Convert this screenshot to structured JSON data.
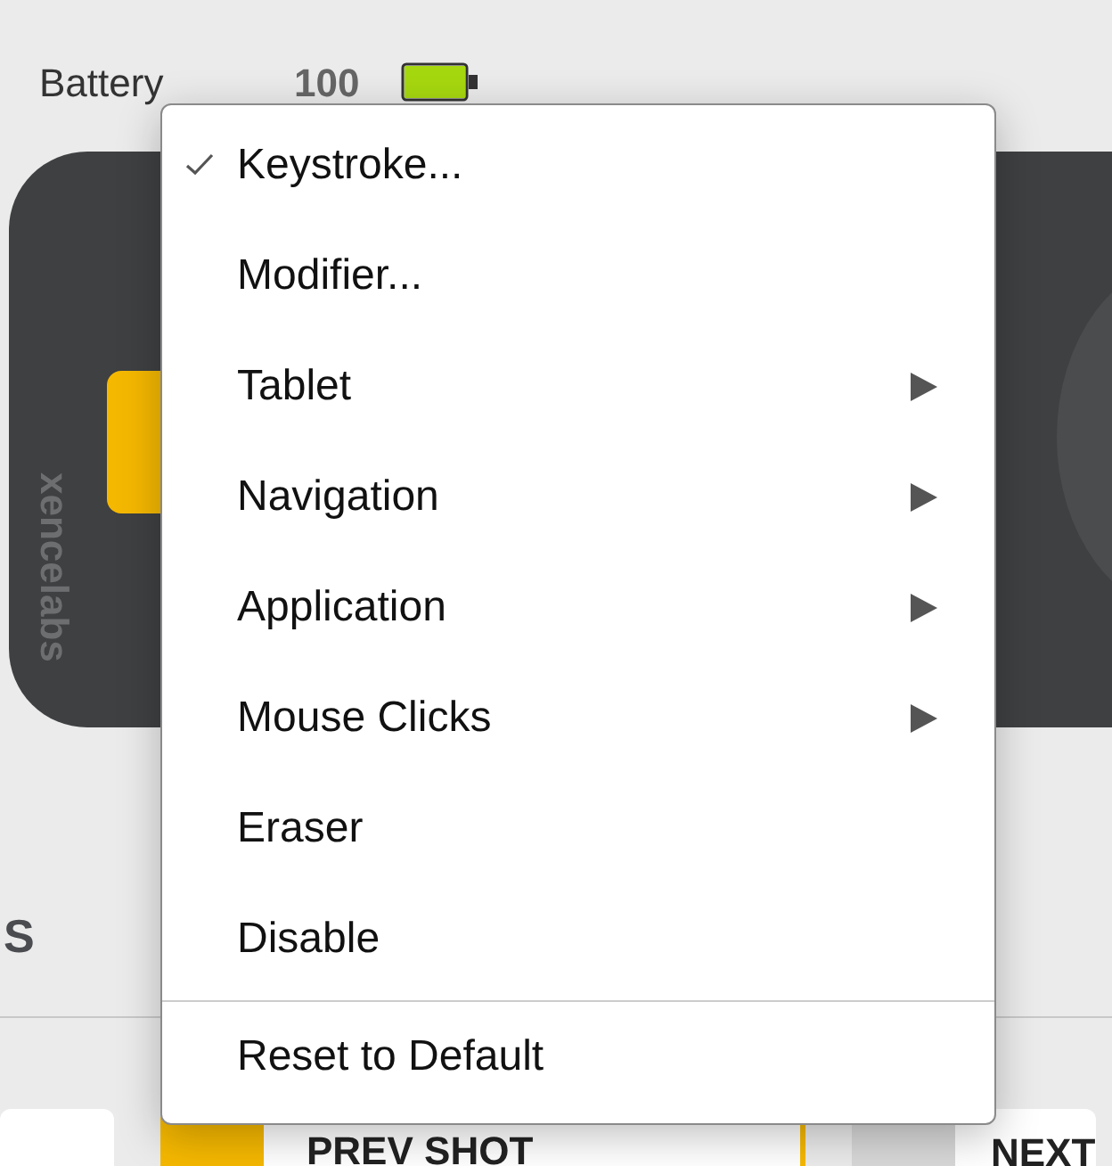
{
  "status": {
    "label": "Battery",
    "value": "100"
  },
  "device": {
    "logo": "xencelabs"
  },
  "section_label": "S",
  "buttons": [
    {
      "label": "PREV SHOT",
      "selected": true
    },
    {
      "label": "NEXT",
      "selected": false
    }
  ],
  "context_menu": {
    "groups": [
      {
        "items": [
          {
            "label": "Keystroke...",
            "checked": true,
            "has_submenu": false
          },
          {
            "label": "Modifier...",
            "checked": false,
            "has_submenu": false
          },
          {
            "label": "Tablet",
            "checked": false,
            "has_submenu": true
          },
          {
            "label": "Navigation",
            "checked": false,
            "has_submenu": true
          },
          {
            "label": "Application",
            "checked": false,
            "has_submenu": true
          },
          {
            "label": "Mouse Clicks",
            "checked": false,
            "has_submenu": true
          },
          {
            "label": "Eraser",
            "checked": false,
            "has_submenu": false
          },
          {
            "label": "Disable",
            "checked": false,
            "has_submenu": false
          }
        ]
      },
      {
        "items": [
          {
            "label": "Reset to Default",
            "checked": false,
            "has_submenu": false
          }
        ]
      }
    ]
  }
}
